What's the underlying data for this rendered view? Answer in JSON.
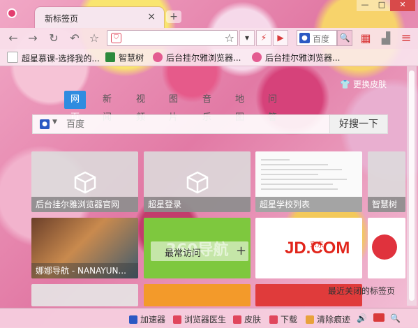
{
  "tab": {
    "title": "新标签页",
    "close": "×",
    "new_tab": "+"
  },
  "window": {
    "min": "—",
    "max": "□",
    "close": "✕"
  },
  "toolbar": {
    "back": "←",
    "forward": "→",
    "reload": "↻",
    "undo": "↶",
    "favorite": "☆",
    "address_value": "",
    "star": "☆",
    "dropdown": "▾",
    "bolt": "⚡",
    "play": "▶",
    "search_engine": "百度",
    "search_go": "🔍",
    "ext": "▦",
    "menu": "≡"
  },
  "bookmarks": [
    {
      "label": "超星慕课-选择我的...",
      "color": "#e03c3c"
    },
    {
      "label": "智慧树",
      "color": "#2c8a3c"
    },
    {
      "label": "后台挂尔雅浏览器...",
      "color": "#e35b90"
    },
    {
      "label": "后台挂尔雅浏览器...",
      "color": "#e35b90"
    }
  ],
  "content": {
    "skin_link": "更换皮肤",
    "search_tabs": [
      "网页",
      "新闻",
      "视频",
      "图片",
      "音乐",
      "地图",
      "问答"
    ],
    "search_placeholder": "百度",
    "search_button": "好搜一下",
    "tiles": [
      {
        "label": "后台挂尔雅浏览器官网"
      },
      {
        "label": "超星登录"
      },
      {
        "label": "超星学校列表"
      },
      {
        "label": "智慧树"
      },
      {
        "label": "娜娜导航 - NANAYUN..."
      },
      {
        "label": "360导航"
      },
      {
        "label": "JD.COM",
        "sub": "京东"
      },
      {
        "label": ""
      }
    ],
    "frequent_label": "最常访问",
    "frequent_plus": "+",
    "recent_closed": "最近关闭的标签页"
  },
  "statusbar": [
    {
      "label": "加速器",
      "color": "#2b59c3"
    },
    {
      "label": "浏览器医生",
      "color": "#e0465c"
    },
    {
      "label": "皮肤",
      "color": "#e0465c"
    },
    {
      "label": "下载",
      "color": "#e0465c"
    },
    {
      "label": "清除痕迹",
      "color": "#e8a23b"
    }
  ],
  "statusbar_icons": {
    "sound": "🔊",
    "zoom": "🔍"
  }
}
